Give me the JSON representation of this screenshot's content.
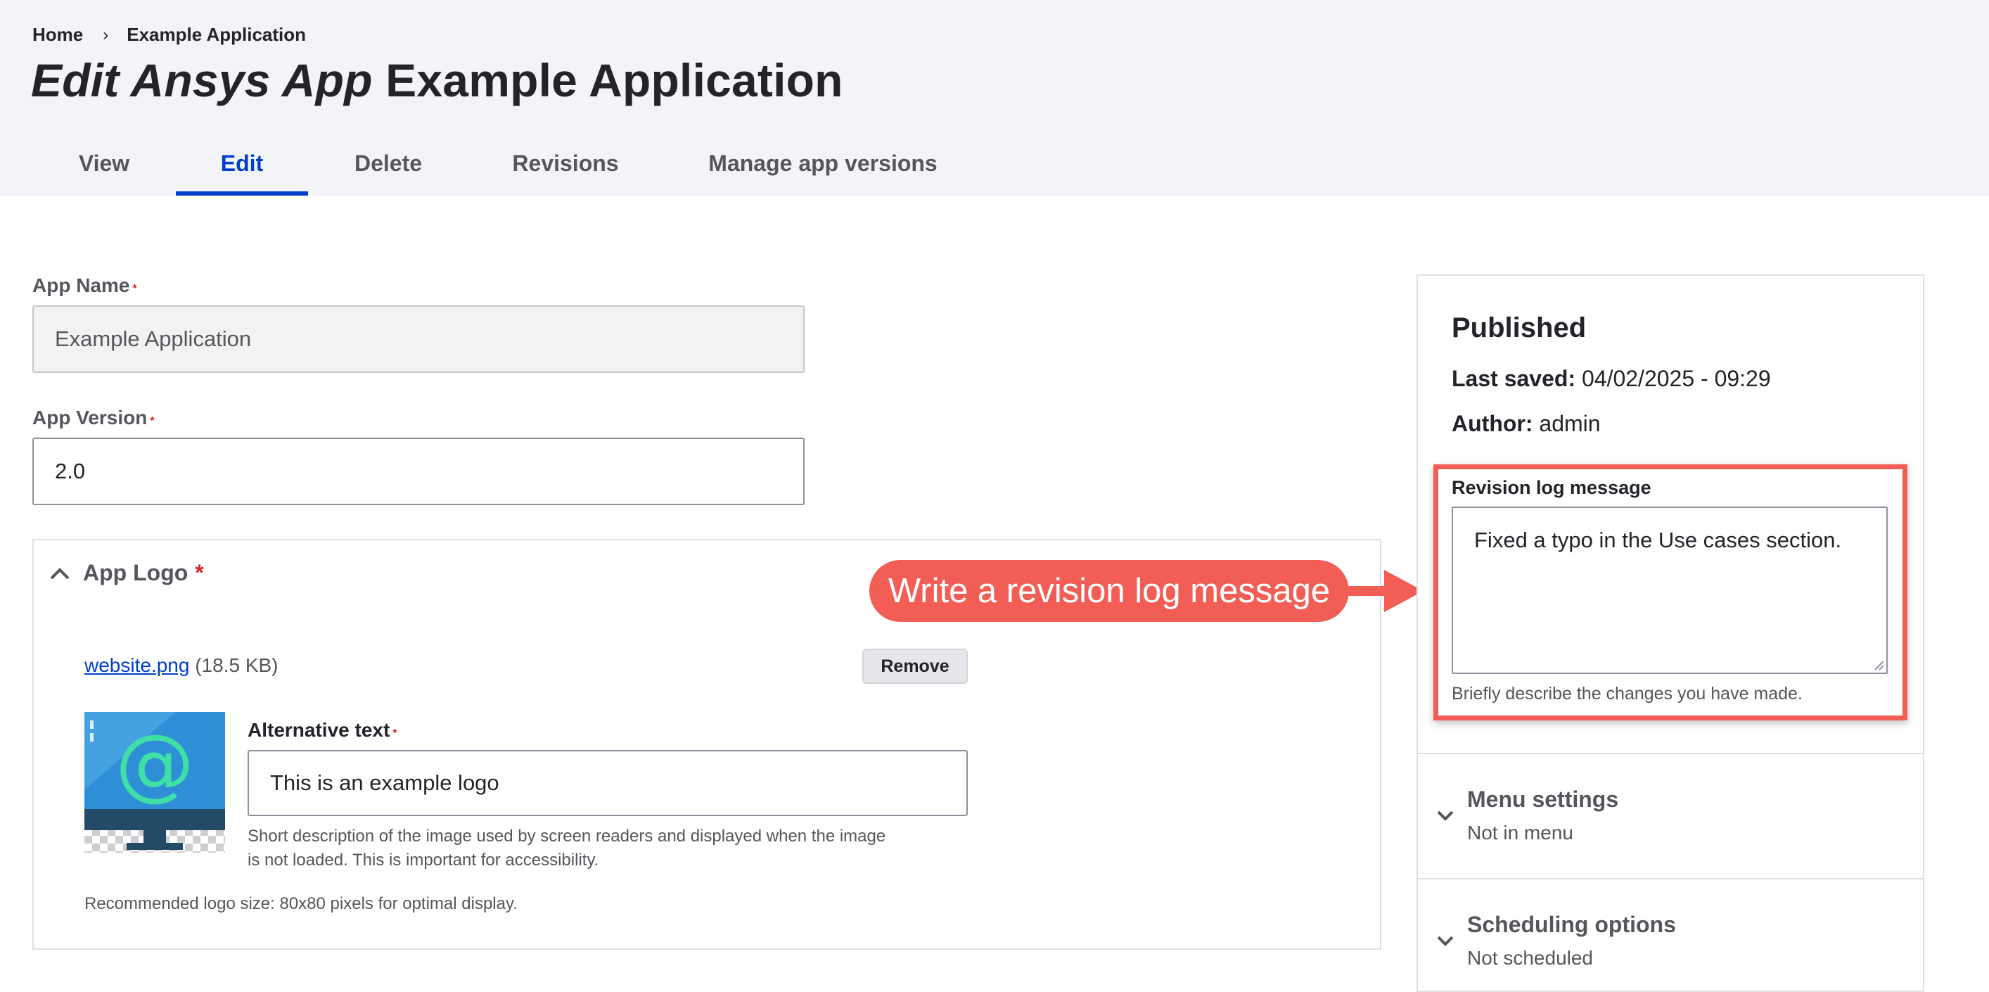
{
  "breadcrumb": {
    "home": "Home",
    "separator": "›",
    "current": "Example Application"
  },
  "page_title": {
    "prefix": "Edit Ansys App",
    "name": "Example Application"
  },
  "tabs": [
    {
      "label": "View"
    },
    {
      "label": "Edit",
      "active": true
    },
    {
      "label": "Delete"
    },
    {
      "label": "Revisions"
    },
    {
      "label": "Manage app versions"
    }
  ],
  "form": {
    "required_marker": "*",
    "app_name": {
      "label": "App Name",
      "value": "Example Application"
    },
    "app_version": {
      "label": "App Version",
      "value": "2.0"
    },
    "app_logo": {
      "title": "App Logo",
      "file_name": "website.png",
      "file_size": "(18.5 KB)",
      "remove_label": "Remove",
      "alt_label": "Alternative text",
      "alt_value": "This is an example logo",
      "alt_desc_line1": "Short description of the image used by screen readers and displayed when the image",
      "alt_desc_line2": "is not loaded. This is important for accessibility.",
      "recommendation": "Recommended logo size: 80x80 pixels for optimal display."
    }
  },
  "sidebar": {
    "status": "Published",
    "last_saved_label": "Last saved:",
    "last_saved_value": "04/02/2025 - 09:29",
    "author_label": "Author:",
    "author_value": "admin",
    "revision": {
      "label": "Revision log message",
      "value": "Fixed a typo in the Use cases section.",
      "desc": "Briefly describe the changes you have made."
    },
    "menu_settings": {
      "title": "Menu settings",
      "sub": "Not in menu"
    },
    "scheduling": {
      "title": "Scheduling options",
      "sub": "Not scheduled"
    }
  },
  "callout": {
    "text": "Write a revision log message"
  },
  "colors": {
    "accent": "#003ecc",
    "callout": "#f25e55",
    "required": "#d72222",
    "header_bg": "#f3f4f9"
  },
  "icons": [
    "chevron-up-icon",
    "chevron-down-icon",
    "arrow-right-icon",
    "resize-handle-icon",
    "monitor-at-logo"
  ]
}
